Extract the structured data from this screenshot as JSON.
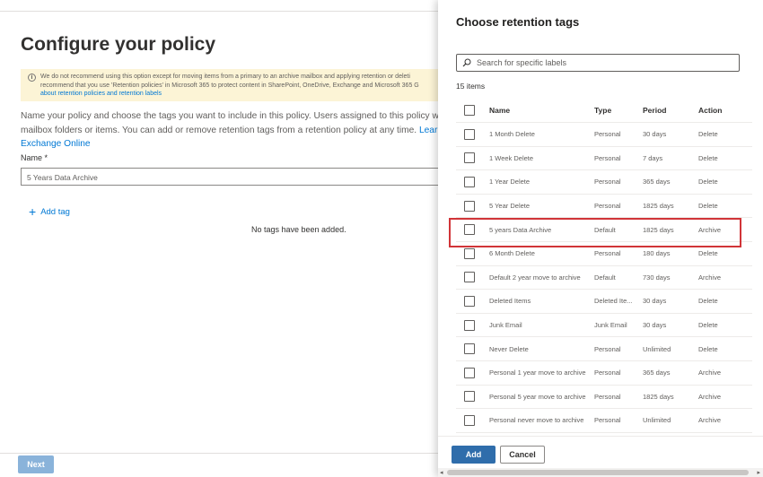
{
  "page": {
    "title": "Configure your policy",
    "warning": {
      "line1": "We do not recommend using this option except for moving items from a primary to an archive mailbox and applying retention or deleti",
      "line2": "recommend that you use 'Retention policies' in Microsoft 365 to protect content in SharePoint, OneDrive, Exchange and Microsoft 365 G",
      "link": "about retention policies and retention labels"
    },
    "description": {
      "line1": "Name your policy and choose the tags you want to include in this policy. Users assigned to this policy will s",
      "line2": "mailbox folders or items. You can add or remove retention tags from a retention policy at any time.",
      "line2_link": "Learn m",
      "line3_link": "Exchange Online"
    },
    "name_label": "Name *",
    "name_value": "5 Years Data Archive",
    "add_tag_label": "Add tag",
    "no_tags_text": "No tags have been added.",
    "next_label": "Next"
  },
  "panel": {
    "title": "Choose retention tags",
    "search_placeholder": "Search for specific labels",
    "items_count": "15 items",
    "columns": {
      "name": "Name",
      "type": "Type",
      "period": "Period",
      "action": "Action"
    },
    "rows": [
      {
        "name": "1 Month Delete",
        "type": "Personal",
        "period": "30 days",
        "action": "Delete"
      },
      {
        "name": "1 Week Delete",
        "type": "Personal",
        "period": "7 days",
        "action": "Delete"
      },
      {
        "name": "1 Year Delete",
        "type": "Personal",
        "period": "365 days",
        "action": "Delete"
      },
      {
        "name": "5 Year Delete",
        "type": "Personal",
        "period": "1825 days",
        "action": "Delete"
      },
      {
        "name": "5 years Data Archive",
        "type": "Default",
        "period": "1825 days",
        "action": "Archive"
      },
      {
        "name": "6 Month Delete",
        "type": "Personal",
        "period": "180 days",
        "action": "Delete"
      },
      {
        "name": "Default 2 year move to archive",
        "type": "Default",
        "period": "730 days",
        "action": "Archive"
      },
      {
        "name": "Deleted Items",
        "type": "Deleted Ite...",
        "period": "30 days",
        "action": "Delete"
      },
      {
        "name": "Junk Email",
        "type": "Junk Email",
        "period": "30 days",
        "action": "Delete"
      },
      {
        "name": "Never Delete",
        "type": "Personal",
        "period": "Unlimited",
        "action": "Delete"
      },
      {
        "name": "Personal 1 year move to archive",
        "type": "Personal",
        "period": "365 days",
        "action": "Archive"
      },
      {
        "name": "Personal 5 year move to archive",
        "type": "Personal",
        "period": "1825 days",
        "action": "Archive"
      },
      {
        "name": "Personal never move to archive",
        "type": "Personal",
        "period": "Unlimited",
        "action": "Archive"
      }
    ],
    "add_label": "Add",
    "cancel_label": "Cancel",
    "scroll_left": "◂",
    "scroll_right": "▸"
  },
  "colors": {
    "accent": "#0078d4",
    "primary_button": "#2f6dab",
    "highlight_border": "#d13438",
    "warning_bg": "#fcf4d6"
  },
  "icons": {
    "search": "search-icon",
    "info": "info-icon",
    "plus": "plus-icon"
  }
}
